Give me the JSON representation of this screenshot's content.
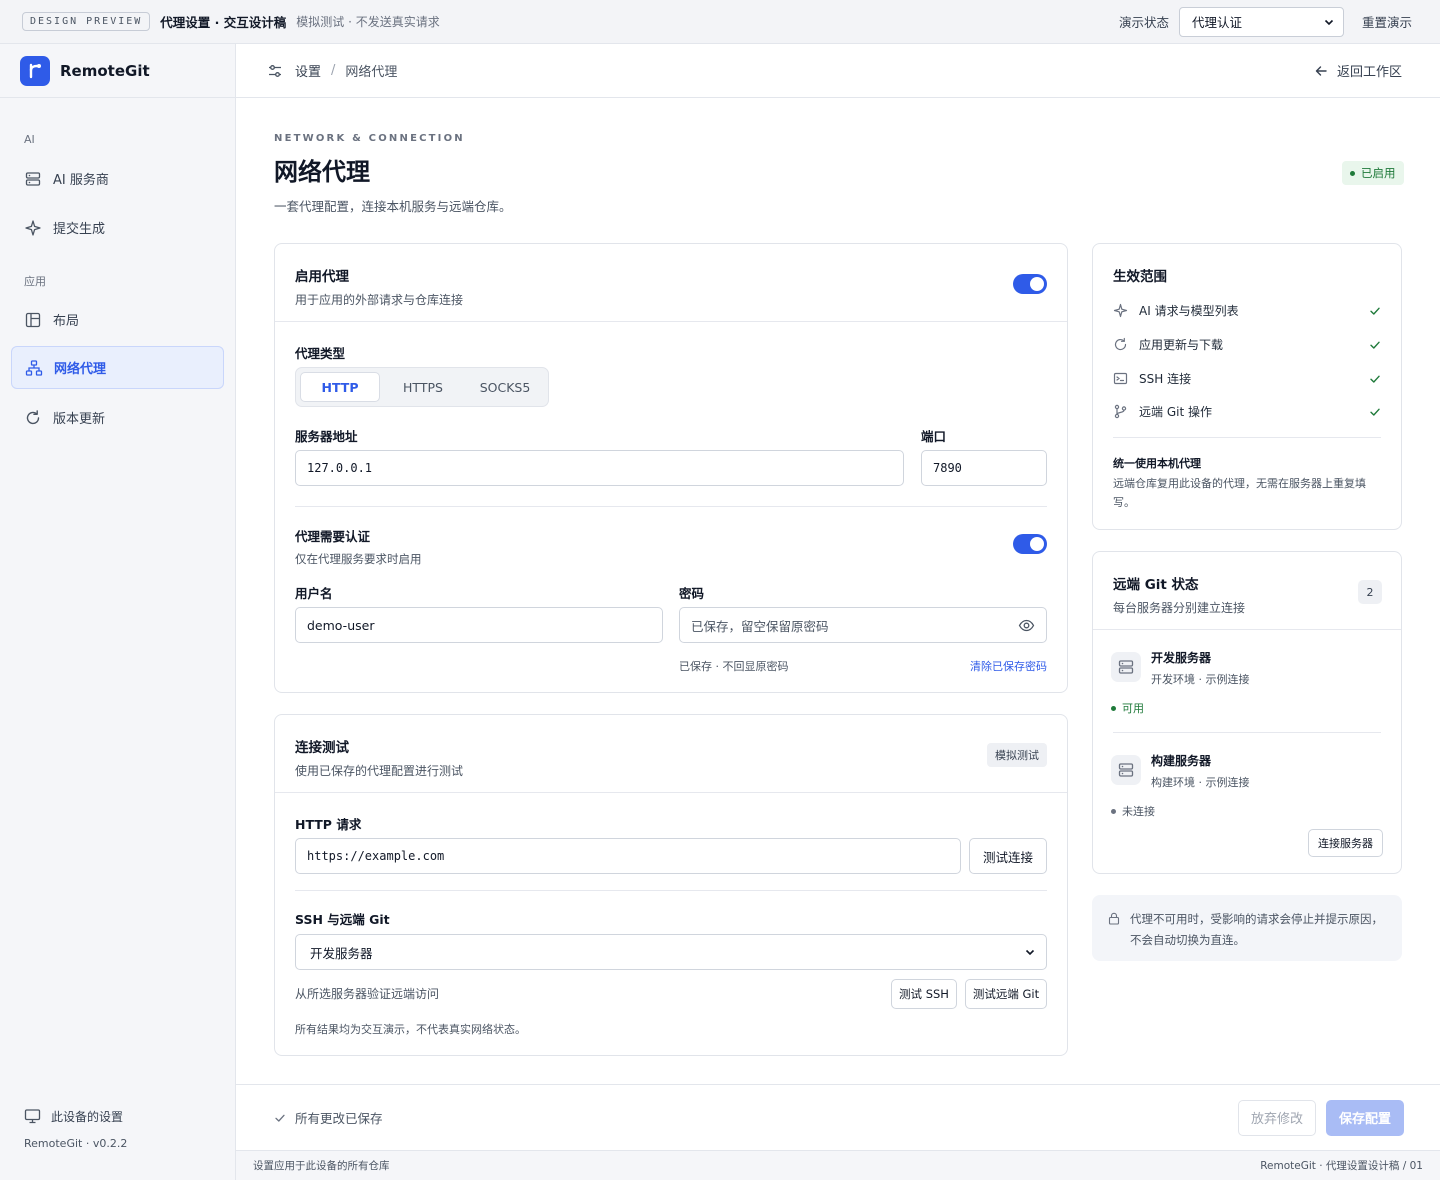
{
  "topbar": {
    "tag": "DESIGN PREVIEW",
    "title": "代理设置 · 交互设计稿",
    "subtitle": "模拟测试 · 不发送真实请求",
    "demo_label": "演示状态",
    "demo_state": "代理认证",
    "reset_label": "重置演示"
  },
  "sidebar": {
    "brand": "RemoteGit",
    "sections": [
      {
        "label": "AI",
        "items": [
          {
            "label": "AI 服务商",
            "icon": "server-icon"
          },
          {
            "label": "提交生成",
            "icon": "sparkle-icon"
          }
        ]
      },
      {
        "label": "应用",
        "items": [
          {
            "label": "布局",
            "icon": "layout-icon"
          },
          {
            "label": "网络代理",
            "icon": "network-icon",
            "active": true
          },
          {
            "label": "版本更新",
            "icon": "refresh-icon"
          }
        ]
      }
    ],
    "footer_label": "此设备的设置",
    "version": "RemoteGit · v0.2.2"
  },
  "header": {
    "crumb_root": "设置",
    "crumb_sep": "/",
    "crumb_current": "网络代理",
    "back_label": "返回工作区"
  },
  "page": {
    "eyebrow": "NETWORK & CONNECTION",
    "title": "网络代理",
    "description": "一套代理配置，连接本机服务与远端仓库。",
    "status_badge": "已启用"
  },
  "proxy_card": {
    "title": "启用代理",
    "subtitle": "用于应用的外部请求与仓库连接",
    "enabled": true,
    "type_label": "代理类型",
    "types": [
      "HTTP",
      "HTTPS",
      "SOCKS5"
    ],
    "selected_type": "HTTP",
    "server_label": "服务器地址",
    "server_value": "127.0.0.1",
    "port_label": "端口",
    "port_value": "7890",
    "auth_title": "代理需要认证",
    "auth_subtitle": "仅在代理服务要求时启用",
    "auth_enabled": true,
    "username_label": "用户名",
    "username_value": "demo-user",
    "password_label": "密码",
    "password_placeholder": "已保存，留空保留原密码",
    "password_hint": "已保存 · 不回显原密码",
    "clear_password_label": "清除已保存密码"
  },
  "test_card": {
    "title": "连接测试",
    "subtitle": "使用已保存的代理配置进行测试",
    "badge": "模拟测试",
    "http_label": "HTTP 请求",
    "http_value": "https://example.com",
    "http_button": "测试连接",
    "ssh_label": "SSH 与远端 Git",
    "server_select": "开发服务器",
    "ssh_desc": "从所选服务器验证远端访问",
    "ssh_button": "测试 SSH",
    "git_button": "测试远端 Git",
    "footnote": "所有结果均为交互演示，不代表真实网络状态。"
  },
  "scope_card": {
    "title": "生效范围",
    "items": [
      {
        "label": "AI 请求与模型列表",
        "icon": "sparkle-icon"
      },
      {
        "label": "应用更新与下载",
        "icon": "refresh-icon"
      },
      {
        "label": "SSH 连接",
        "icon": "terminal-icon"
      },
      {
        "label": "远端 Git 操作",
        "icon": "git-branch-icon"
      }
    ],
    "note_title": "统一使用本机代理",
    "note_text": "远端仓库复用此设备的代理，无需在服务器上重复填写。"
  },
  "git_status_card": {
    "title": "远端 Git 状态",
    "subtitle": "每台服务器分别建立连接",
    "count": "2",
    "servers": [
      {
        "name": "开发服务器",
        "desc": "开发环境 · 示例连接",
        "status": "可用",
        "status_color": "#1f7a3a"
      },
      {
        "name": "构建服务器",
        "desc": "构建环境 · 示例连接",
        "status": "未连接",
        "status_color": "#4b5563"
      }
    ],
    "connect_button": "连接服务器"
  },
  "notice": {
    "text": "代理不可用时，受影响的请求会停止并提示原因，不会自动切换为直连。"
  },
  "footer": {
    "saved_label": "所有更改已保存",
    "discard_label": "放弃修改",
    "save_label": "保存配置"
  },
  "status_bar": {
    "left": "设置应用于此设备的所有仓库",
    "right": "RemoteGit · 代理设置设计稿 / 01"
  },
  "colors": {
    "accent": "#2f5be8",
    "success": "#1f7a3a",
    "primary_disabled": "#a9bcf5"
  }
}
